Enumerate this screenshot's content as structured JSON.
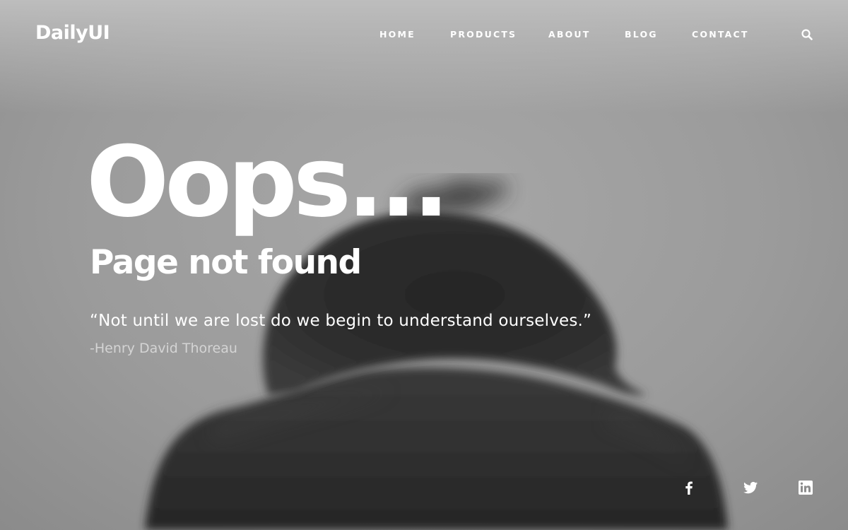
{
  "brand": {
    "logo_text": "DailyUI"
  },
  "nav": {
    "items": [
      {
        "label": "HOME"
      },
      {
        "label": "PRODUCTS"
      },
      {
        "label": "ABOUT"
      },
      {
        "label": "BLOG"
      },
      {
        "label": "CONTACT"
      }
    ],
    "search_icon": "search-icon"
  },
  "hero": {
    "headline": "Oops...",
    "subheadline": "Page not found",
    "quote": "“Not until we are lost do we begin to understand ourselves.”",
    "author": "-Henry David Thoreau"
  },
  "social": {
    "icons": [
      "facebook-icon",
      "twitter-icon",
      "linkedin-icon"
    ]
  },
  "colors": {
    "text": "#ffffff",
    "author_text": "#d4d4d4",
    "background": "#9b9b9b",
    "figure": "#2e2e2e"
  }
}
